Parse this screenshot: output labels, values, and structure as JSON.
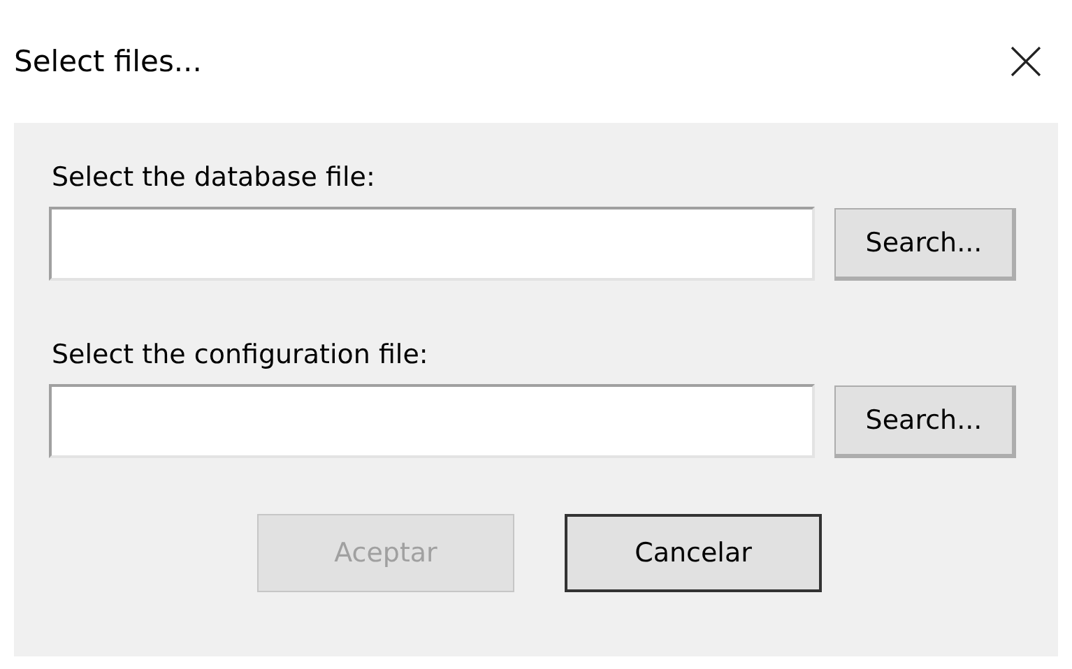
{
  "window": {
    "title": "Select files..."
  },
  "fields": [
    {
      "label": "Select the database file:",
      "button": "Search..."
    },
    {
      "label": "Select the configuration file:",
      "button": "Search..."
    }
  ],
  "buttons": [
    {
      "label": "Aceptar",
      "disabled": true,
      "focused": false
    },
    {
      "label": "Cancelar",
      "disabled": false,
      "focused": true
    }
  ]
}
